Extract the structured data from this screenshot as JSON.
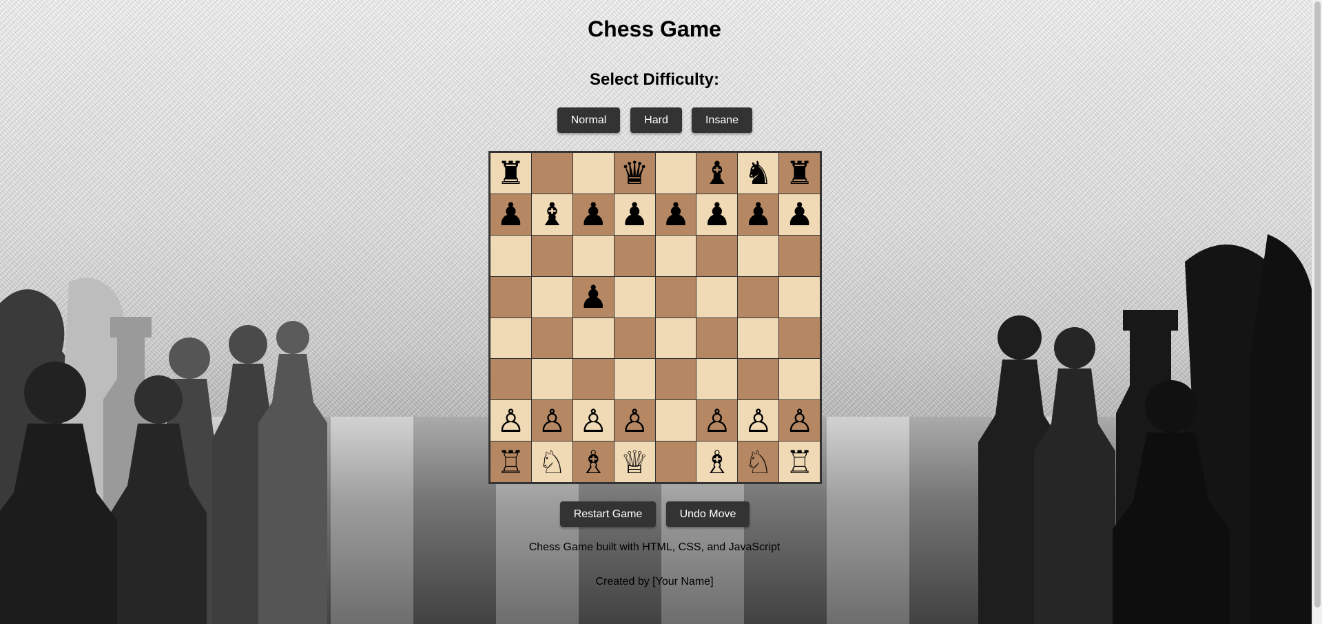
{
  "title": "Chess Game",
  "difficulty": {
    "heading": "Select Difficulty:",
    "options": [
      "Normal",
      "Hard",
      "Insane"
    ]
  },
  "board": {
    "rows": [
      [
        "♜",
        "",
        "",
        "♛",
        "",
        "♝",
        "♞",
        "♜"
      ],
      [
        "♟",
        "♝",
        "♟",
        "♟",
        "♟",
        "♟",
        "♟",
        "♟"
      ],
      [
        "",
        "",
        "",
        "",
        "",
        "",
        "",
        ""
      ],
      [
        "",
        "",
        "♟",
        "",
        "",
        "",
        "",
        ""
      ],
      [
        "",
        "",
        "",
        "",
        "",
        "",
        "",
        ""
      ],
      [
        "",
        "",
        "",
        "",
        "",
        "",
        "",
        ""
      ],
      [
        "♙",
        "♙",
        "♙",
        "♙",
        "",
        "♙",
        "♙",
        "♙"
      ],
      [
        "♖",
        "♘",
        "♗",
        "♕",
        "",
        "♗",
        "♘",
        "♖"
      ]
    ],
    "light_color": "#f0d9b5",
    "dark_color": "#b58863"
  },
  "controls": {
    "restart_label": "Restart Game",
    "undo_label": "Undo Move"
  },
  "footer": {
    "built_with": "Chess Game built with HTML, CSS, and JavaScript",
    "credit": "Created by [Your Name]"
  },
  "colors": {
    "button_bg": "#333333",
    "button_text": "#ffffff"
  }
}
